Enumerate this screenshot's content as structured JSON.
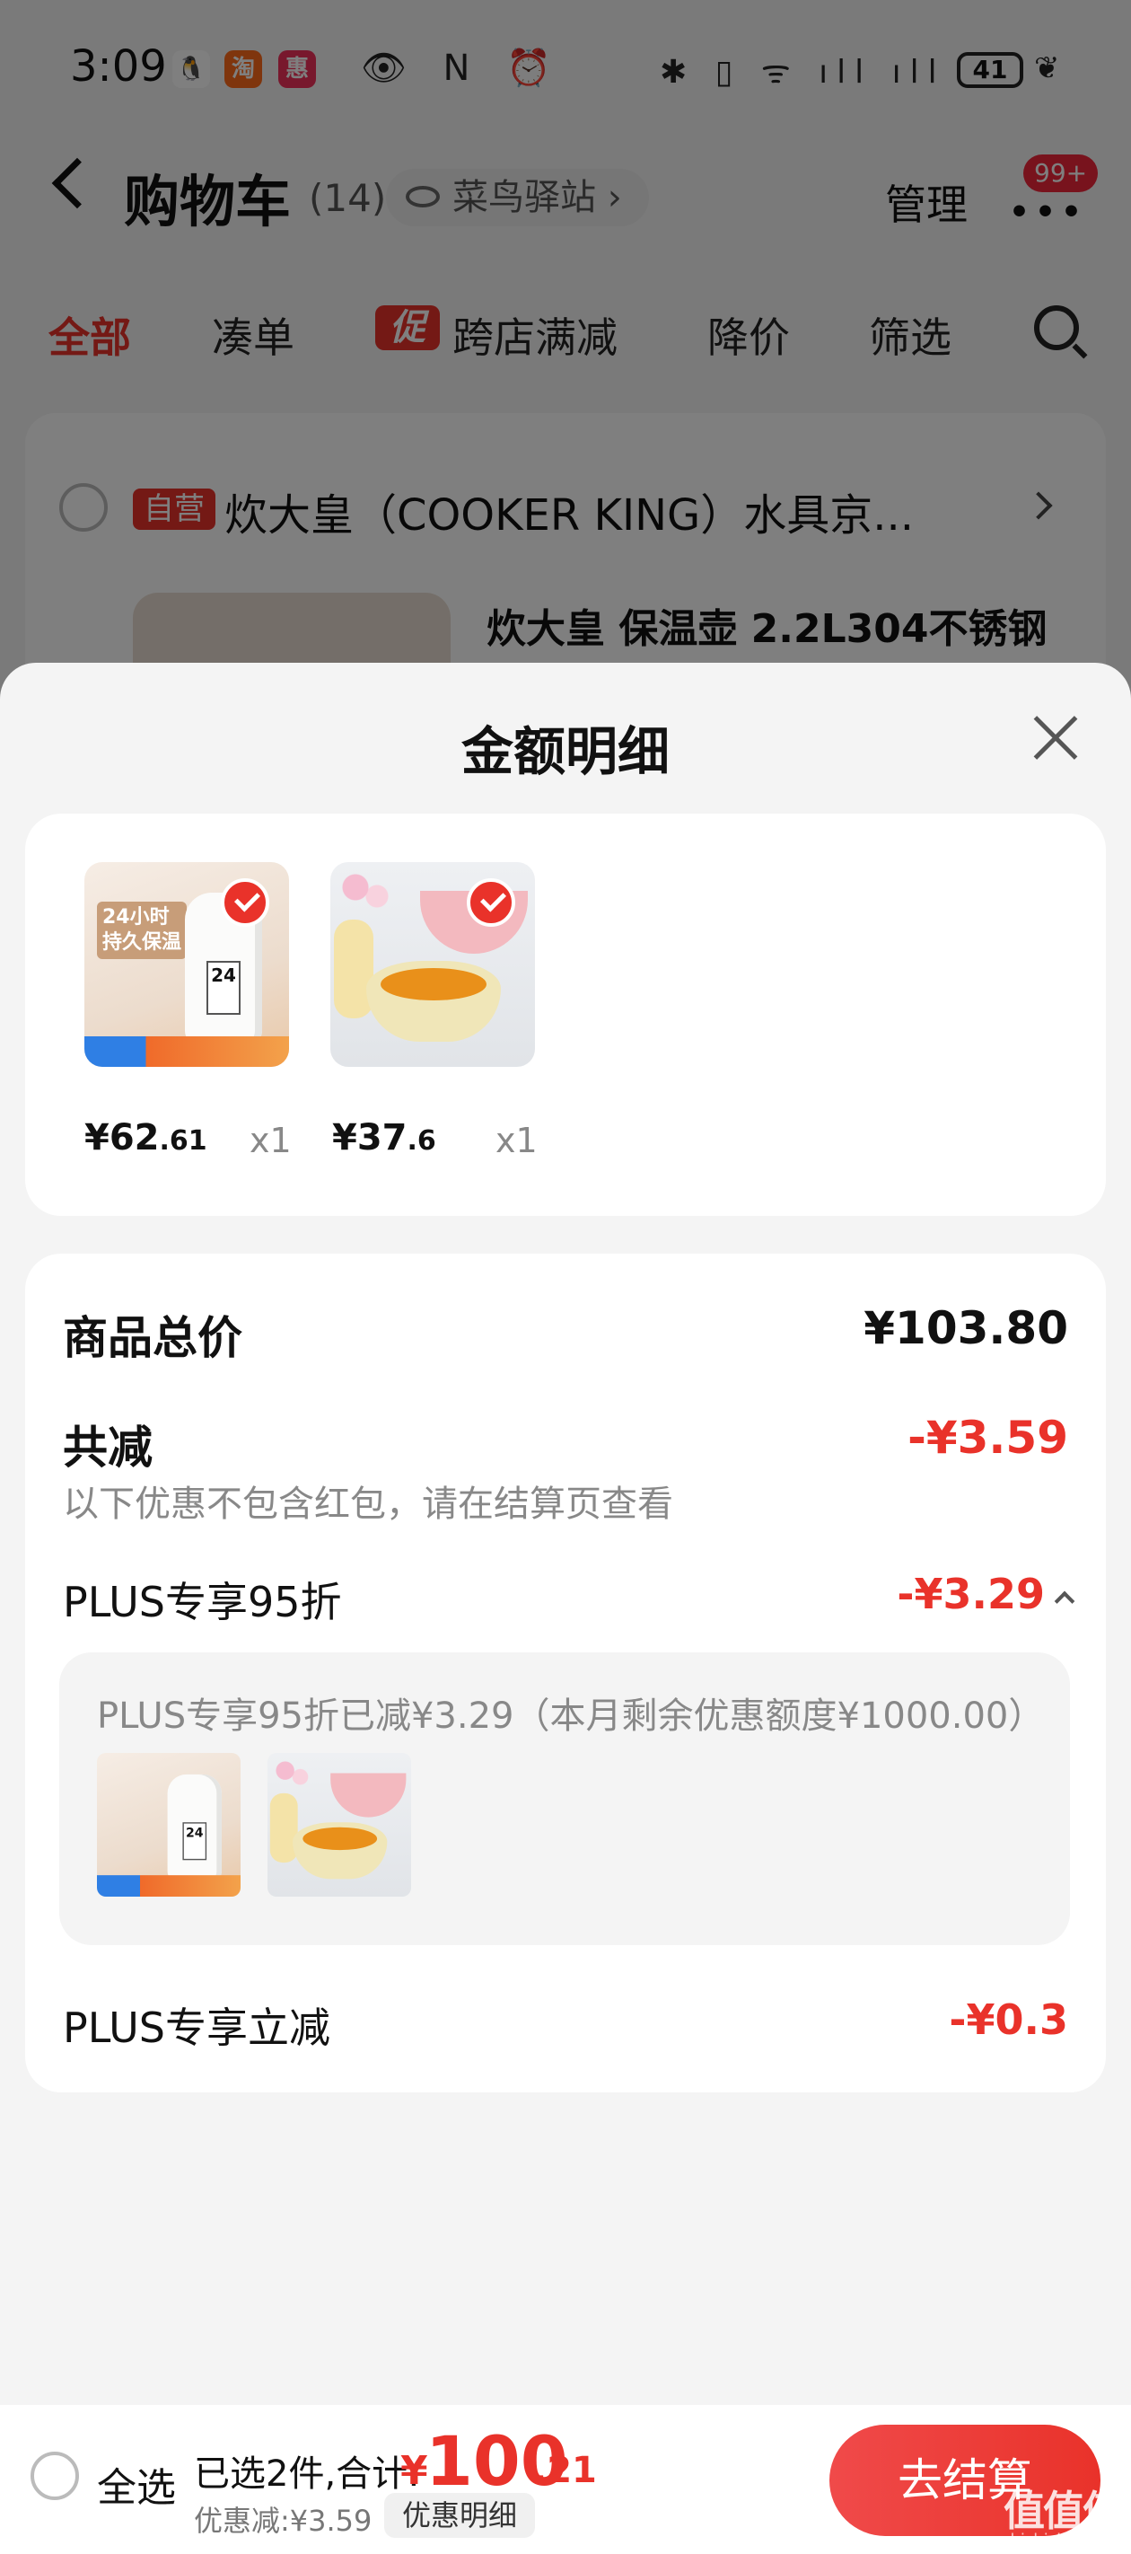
{
  "status_bar": {
    "time": "3:09",
    "apps": [
      {
        "name": "qq-icon",
        "glyph": "🐧",
        "color": "#ffffff"
      },
      {
        "name": "taobao-icon",
        "glyph": "淘",
        "color": "#ff6a1a"
      },
      {
        "name": "app-icon",
        "glyph": "惠",
        "color": "#f0305a"
      }
    ],
    "left_icons": "👁 N ⏰",
    "right_icons": "✱ ▯ ᯤ ıll ıll",
    "battery": "41"
  },
  "header": {
    "title": "购物车",
    "count": "(14)",
    "station": "菜鸟驿站",
    "manage": "管理",
    "badge": "99+"
  },
  "tabs": [
    {
      "label": "全部",
      "active": true
    },
    {
      "label": "凑单",
      "active": false
    },
    {
      "label": "跨店满减",
      "active": false,
      "tag": "促"
    },
    {
      "label": "降价",
      "active": false
    },
    {
      "label": "筛选",
      "active": false
    }
  ],
  "store": {
    "tag": "自营",
    "name": "炊大皇（COOKER KING）水具京...",
    "product_title": "炊大皇 保温壶 2.2L304不锈钢"
  },
  "sheet": {
    "title": "金额明细",
    "items": [
      {
        "price_int": "¥62",
        "price_dec": ".61",
        "qty": "x1",
        "image": "kettle",
        "img_text": "24小时\n持久保温",
        "img_num": "24"
      },
      {
        "price_int": "¥37",
        "price_dec": ".6",
        "qty": "x1",
        "image": "bowl"
      }
    ],
    "total_label": "商品总价",
    "total_value": "¥103.80",
    "reduce_label": "共减",
    "reduce_value": "-¥3.59",
    "note": "以下优惠不包含红包，请在结算页查看",
    "plus95_label": "PLUS专享95折",
    "plus95_value": "-¥3.29",
    "plus95_detail": "PLUS专享95折已减¥3.29（本月剩余优惠额度¥1000.00）",
    "plus_instant_label": "PLUS专享立减",
    "plus_instant_value": "-¥0.3"
  },
  "footer": {
    "select_all": "全选",
    "selected": "已选2件,合计:",
    "yen": "¥",
    "total_int": "100",
    "total_dec": ".21",
    "saved": "优惠减:¥3.59",
    "detail_btn": "优惠明细",
    "checkout": "去结算",
    "watermark": "值值值",
    "watermark_sub": "zhizhizhi.com"
  },
  "colors": {
    "accent": "#e9322a",
    "overlay": "rgba(0,0,0,0.5)"
  }
}
